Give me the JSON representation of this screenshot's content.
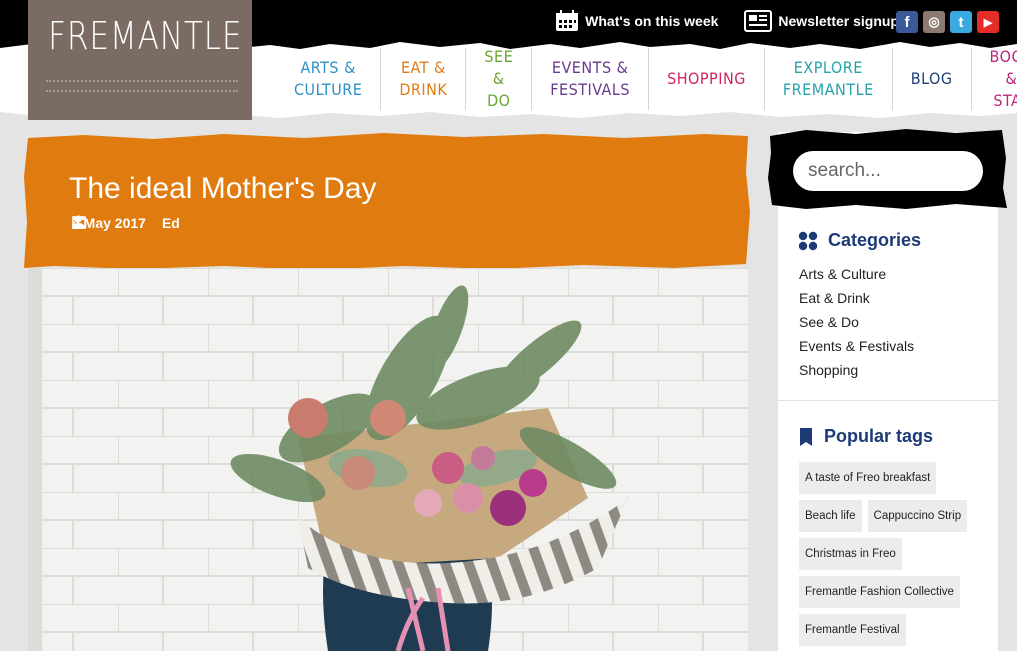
{
  "header": {
    "logo_text": "FREMANTLE",
    "top_links": [
      {
        "label": "What's on this week",
        "icon": "calendar-icon"
      },
      {
        "label": "Newsletter signup",
        "icon": "newspaper-icon"
      }
    ],
    "social": [
      {
        "icon": "facebook-icon",
        "glyph": "f",
        "color": "#3b5998"
      },
      {
        "icon": "instagram-icon",
        "glyph": "◎",
        "color": "#8a7a70"
      },
      {
        "icon": "twitter-icon",
        "glyph": "t",
        "color": "#3aa9e0"
      },
      {
        "icon": "youtube-icon",
        "glyph": "▶",
        "color": "#e52d27"
      }
    ]
  },
  "nav": [
    {
      "line1": "ARTS &",
      "line2": "CULTURE",
      "color": "#2f8fc6"
    },
    {
      "line1": "EAT &",
      "line2": "DRINK",
      "color": "#e07c16"
    },
    {
      "line1": "SEE & DO",
      "line2": "",
      "color": "#69a532"
    },
    {
      "line1": "EVENTS &",
      "line2": "FESTIVALS",
      "color": "#6a3a8e"
    },
    {
      "line1": "SHOPPING",
      "line2": "",
      "color": "#d0245b"
    },
    {
      "line1": "EXPLORE",
      "line2": "FREMANTLE",
      "color": "#26a3a8"
    },
    {
      "line1": "BLOG",
      "line2": "",
      "color": "#1d3d75"
    },
    {
      "line1": "BOOK",
      "line2": "& STAY",
      "color": "#c0217e"
    }
  ],
  "article": {
    "title": "The ideal Mother's Day",
    "date": "4 May 2017",
    "author": "Ed",
    "accent": "#e07c0f"
  },
  "sidebar": {
    "search_placeholder": "search...",
    "categories_title": "Categories",
    "categories": [
      "Arts & Culture",
      "Eat & Drink",
      "See & Do",
      "Events & Festivals",
      "Shopping"
    ],
    "tags_title": "Popular tags",
    "tags": [
      "A taste of Freo breakfast",
      "Beach life",
      "Cappuccino Strip",
      "Christmas in Freo",
      "Fremantle Fashion Collective",
      "Fremantle Festival"
    ]
  }
}
